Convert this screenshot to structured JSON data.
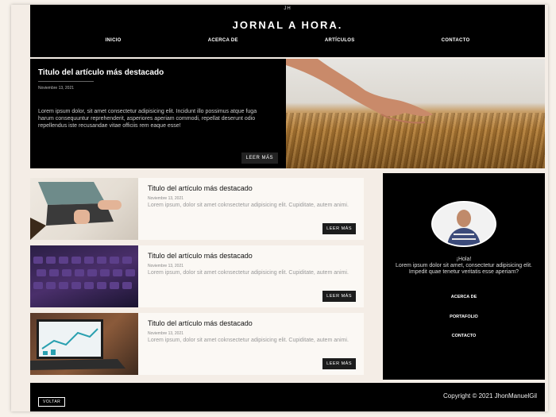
{
  "header": {
    "brand_small": "JH",
    "brand": "JORNAL A HORA.",
    "nav": [
      "INICIO",
      "ACERCA DE",
      "ARTÍCULOS",
      "CONTACTO"
    ]
  },
  "hero": {
    "title": "Titulo del artículo más destacado",
    "date": "Noviembre 13, 2021",
    "text": "Lorem ipsum dolor, sit amet consectetur adipisicing elit. Incidunt illo possimus atque fuga harum consequuntur reprehenderit, asperiores aperiam commodi, repellat deserunt odio repellendus iste recusandae vitae officiis rem eaque esse!",
    "button": "LEER MÁS"
  },
  "cards": [
    {
      "title": "Titulo del artículo más destacado",
      "date": "Noviembre 13, 2021",
      "text": "Lorem ipsum, dolor sit amet coknsectetur adipisicing elit. Cupiditate, autem animi.",
      "button": "LEER MÁS"
    },
    {
      "title": "Titulo del artículo más destacado",
      "date": "Noviembre 13, 2021",
      "text": "Lorem ipsum, dolor sit amet coknsectetur adipisicing elit. Cupiditate, autem animi.",
      "button": "LEER MÁS"
    },
    {
      "title": "Titulo del artículo más destacado",
      "date": "Noviembre 13, 2021",
      "text": "Lorem ipsum, dolor sit amet coknsectetur adipisicing elit. Cupiditate, autem animi.",
      "button": "LEER MÁS"
    }
  ],
  "sidebar": {
    "greeting": "¡Hola!",
    "text": "Lorem ipsum dolor sit amet, consectetur adipisicing elit. Impedit quae tenetur veritatis esse aperiam?",
    "links": [
      "ACERCA DE",
      "PORTAFOLIO",
      "CONTACTO"
    ]
  },
  "footer": {
    "back": "VOLTAR",
    "copyright": "Copyright © 2021 JhonManuelGil"
  },
  "colors": {
    "background": "#f4ede6",
    "panel": "#000000",
    "card": "#fbf8f4"
  }
}
